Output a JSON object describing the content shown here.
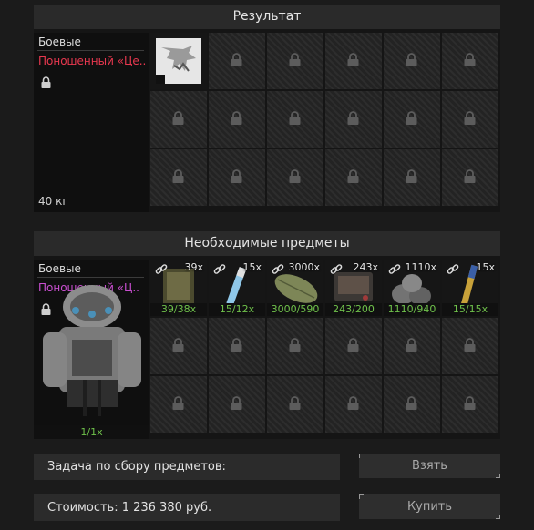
{
  "result": {
    "title": "Результат",
    "category": "Боевые",
    "item_name": "Поношенный «Це..",
    "weight": "40 кг"
  },
  "required": {
    "title": "Необходимые предметы",
    "category": "Боевые",
    "item_name": "Поношенный «Ц..",
    "progress": "1/1x",
    "items": [
      {
        "count": "39x",
        "progress": "39/38x",
        "icon": "notebook-icon"
      },
      {
        "count": "15x",
        "progress": "15/12x",
        "icon": "vial-icon"
      },
      {
        "count": "3000x",
        "progress": "3000/590",
        "icon": "leaf-icon"
      },
      {
        "count": "243x",
        "progress": "243/200",
        "icon": "battery-icon"
      },
      {
        "count": "1110x",
        "progress": "1110/940",
        "icon": "stones-icon"
      },
      {
        "count": "15x",
        "progress": "15/15x",
        "icon": "syringe-icon"
      }
    ]
  },
  "task": {
    "label": "Задача по сбору предметов:"
  },
  "cost": {
    "label": "Стоимость: 1 236 380 руб."
  },
  "buttons": {
    "take": "Взять",
    "buy": "Купить"
  },
  "colors": {
    "result_name": "#e8384f",
    "required_name": "#c94fd0",
    "progress": "#6fc14b"
  }
}
